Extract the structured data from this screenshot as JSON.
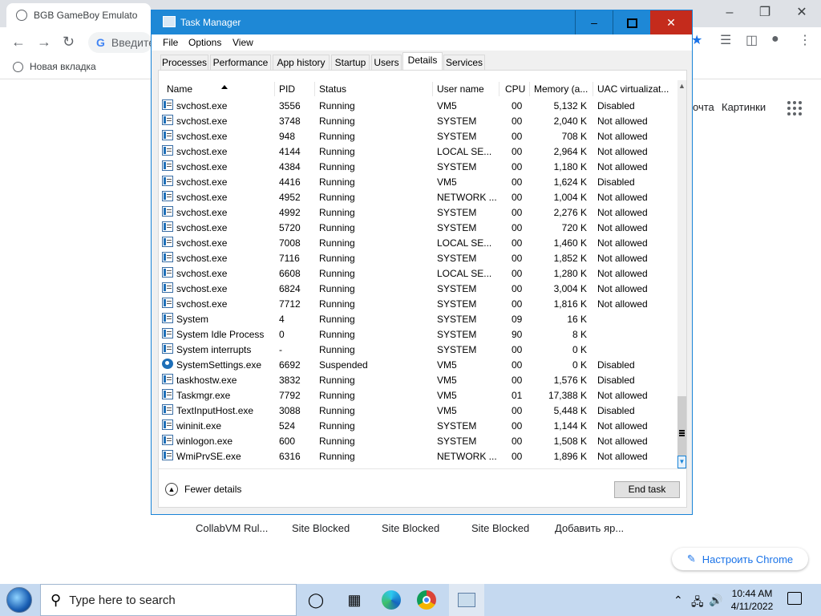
{
  "chrome": {
    "tab_title": "BGB GameBoy Emulato",
    "omnibox_text": "Введите",
    "bookmark_label": "Новая вкладка",
    "google_links": [
      "очта",
      "Картинки"
    ],
    "shortcuts": [
      "CollabVM Rul...",
      "Site Blocked",
      "Site Blocked",
      "Site Blocked",
      "Добавить яр..."
    ],
    "customize_label": "Настроить Chrome"
  },
  "task_manager": {
    "title": "Task Manager",
    "menu": [
      "File",
      "Options",
      "View"
    ],
    "tabs": [
      "Processes",
      "Performance",
      "App history",
      "Startup",
      "Users",
      "Details",
      "Services"
    ],
    "active_tab": "Details",
    "columns": [
      "Name",
      "PID",
      "Status",
      "User name",
      "CPU",
      "Memory (a...",
      "UAC virtualizat..."
    ],
    "rows": [
      {
        "name": "svchost.exe",
        "pid": "3556",
        "status": "Running",
        "user": "VM5",
        "cpu": "00",
        "mem": "5,132 K",
        "uac": "Disabled",
        "icon": "service-icon"
      },
      {
        "name": "svchost.exe",
        "pid": "3748",
        "status": "Running",
        "user": "SYSTEM",
        "cpu": "00",
        "mem": "2,040 K",
        "uac": "Not allowed",
        "icon": "service-icon"
      },
      {
        "name": "svchost.exe",
        "pid": "948",
        "status": "Running",
        "user": "SYSTEM",
        "cpu": "00",
        "mem": "708 K",
        "uac": "Not allowed",
        "icon": "service-icon"
      },
      {
        "name": "svchost.exe",
        "pid": "4144",
        "status": "Running",
        "user": "LOCAL SE...",
        "cpu": "00",
        "mem": "2,964 K",
        "uac": "Not allowed",
        "icon": "service-icon"
      },
      {
        "name": "svchost.exe",
        "pid": "4384",
        "status": "Running",
        "user": "SYSTEM",
        "cpu": "00",
        "mem": "1,180 K",
        "uac": "Not allowed",
        "icon": "service-icon"
      },
      {
        "name": "svchost.exe",
        "pid": "4416",
        "status": "Running",
        "user": "VM5",
        "cpu": "00",
        "mem": "1,624 K",
        "uac": "Disabled",
        "icon": "service-icon"
      },
      {
        "name": "svchost.exe",
        "pid": "4952",
        "status": "Running",
        "user": "NETWORK ...",
        "cpu": "00",
        "mem": "1,004 K",
        "uac": "Not allowed",
        "icon": "service-icon"
      },
      {
        "name": "svchost.exe",
        "pid": "4992",
        "status": "Running",
        "user": "SYSTEM",
        "cpu": "00",
        "mem": "2,276 K",
        "uac": "Not allowed",
        "icon": "service-icon"
      },
      {
        "name": "svchost.exe",
        "pid": "5720",
        "status": "Running",
        "user": "SYSTEM",
        "cpu": "00",
        "mem": "720 K",
        "uac": "Not allowed",
        "icon": "service-icon"
      },
      {
        "name": "svchost.exe",
        "pid": "7008",
        "status": "Running",
        "user": "LOCAL SE...",
        "cpu": "00",
        "mem": "1,460 K",
        "uac": "Not allowed",
        "icon": "service-icon"
      },
      {
        "name": "svchost.exe",
        "pid": "7116",
        "status": "Running",
        "user": "SYSTEM",
        "cpu": "00",
        "mem": "1,852 K",
        "uac": "Not allowed",
        "icon": "service-icon"
      },
      {
        "name": "svchost.exe",
        "pid": "6608",
        "status": "Running",
        "user": "LOCAL SE...",
        "cpu": "00",
        "mem": "1,280 K",
        "uac": "Not allowed",
        "icon": "service-icon"
      },
      {
        "name": "svchost.exe",
        "pid": "6824",
        "status": "Running",
        "user": "SYSTEM",
        "cpu": "00",
        "mem": "3,004 K",
        "uac": "Not allowed",
        "icon": "service-icon"
      },
      {
        "name": "svchost.exe",
        "pid": "7712",
        "status": "Running",
        "user": "SYSTEM",
        "cpu": "00",
        "mem": "1,816 K",
        "uac": "Not allowed",
        "icon": "service-icon"
      },
      {
        "name": "System",
        "pid": "4",
        "status": "Running",
        "user": "SYSTEM",
        "cpu": "09",
        "mem": "16 K",
        "uac": "",
        "icon": "service-icon"
      },
      {
        "name": "System Idle Process",
        "pid": "0",
        "status": "Running",
        "user": "SYSTEM",
        "cpu": "90",
        "mem": "8 K",
        "uac": "",
        "icon": "service-icon"
      },
      {
        "name": "System interrupts",
        "pid": "-",
        "status": "Running",
        "user": "SYSTEM",
        "cpu": "00",
        "mem": "0 K",
        "uac": "",
        "icon": "service-icon"
      },
      {
        "name": "SystemSettings.exe",
        "pid": "6692",
        "status": "Suspended",
        "user": "VM5",
        "cpu": "00",
        "mem": "0 K",
        "uac": "Disabled",
        "icon": "gear-icon"
      },
      {
        "name": "taskhostw.exe",
        "pid": "3832",
        "status": "Running",
        "user": "VM5",
        "cpu": "00",
        "mem": "1,576 K",
        "uac": "Disabled",
        "icon": "service-icon"
      },
      {
        "name": "Taskmgr.exe",
        "pid": "7792",
        "status": "Running",
        "user": "VM5",
        "cpu": "01",
        "mem": "17,388 K",
        "uac": "Not allowed",
        "icon": "taskmgr-icon"
      },
      {
        "name": "TextInputHost.exe",
        "pid": "3088",
        "status": "Running",
        "user": "VM5",
        "cpu": "00",
        "mem": "5,448 K",
        "uac": "Disabled",
        "icon": "service-icon"
      },
      {
        "name": "wininit.exe",
        "pid": "524",
        "status": "Running",
        "user": "SYSTEM",
        "cpu": "00",
        "mem": "1,144 K",
        "uac": "Not allowed",
        "icon": "service-icon"
      },
      {
        "name": "winlogon.exe",
        "pid": "600",
        "status": "Running",
        "user": "SYSTEM",
        "cpu": "00",
        "mem": "1,508 K",
        "uac": "Not allowed",
        "icon": "service-icon"
      },
      {
        "name": "WmiPrvSE.exe",
        "pid": "6316",
        "status": "Running",
        "user": "NETWORK ...",
        "cpu": "00",
        "mem": "1,896 K",
        "uac": "Not allowed",
        "icon": "service-icon"
      }
    ],
    "fewer_details": "Fewer details",
    "end_task": "End task"
  },
  "taskbar": {
    "search_placeholder": "Type here to search",
    "time": "10:44 AM",
    "date": "4/11/2022"
  },
  "colors": {
    "titlebar": "#1e88d6",
    "close": "#c42b1c",
    "taskbar": "#c5d9f0"
  }
}
